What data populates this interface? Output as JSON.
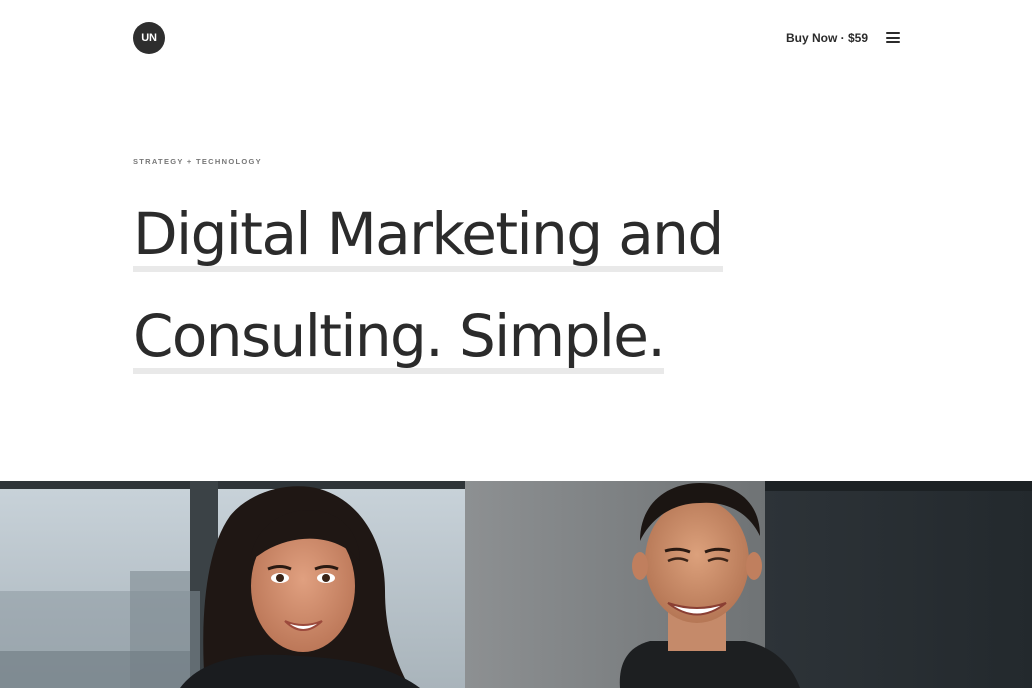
{
  "header": {
    "logo_text": "UN",
    "buy_label": "Buy Now · $59",
    "menu_icon": "hamburger-menu-icon"
  },
  "hero": {
    "eyebrow": "STRATEGY + TECHNOLOGY",
    "headline_line1": "Digital Marketing and",
    "headline_line2": "Consulting. Simple."
  },
  "photo": {
    "subject": "two-smiling-people-photo"
  },
  "colors": {
    "text": "#2b2b2b",
    "logo_bg": "#2e2e2e",
    "underline": "#e9e9e9",
    "eyebrow": "#777777"
  }
}
